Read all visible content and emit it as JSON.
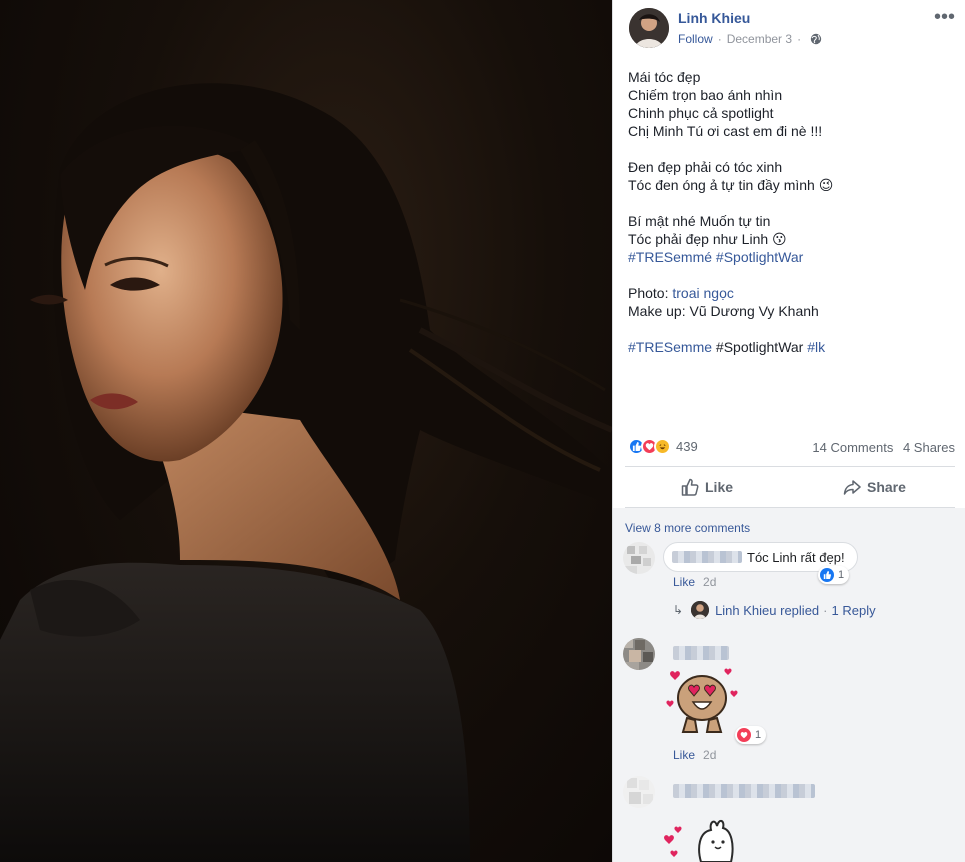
{
  "post": {
    "author": "Linh Khieu",
    "follow_label": "Follow",
    "separator": "·",
    "date": "December 3",
    "privacy_icon": "globe-icon",
    "more_label": "•••",
    "lines": [
      "Mái tóc đẹp",
      "Chiếm trọn bao ánh nhìn",
      "Chinh phục cả spotlight",
      "Chị Minh Tú ơi cast em đi nè !!!",
      "",
      "Đen đẹp phải có tóc xinh",
      "Tóc đen óng ả tự tin đầy mình 😉",
      "",
      "Bí mật nhé Muốn tự tin",
      "Tóc phải đẹp như Linh 😗"
    ],
    "hashtags_1": "#TRESemmé #SpotlightWar",
    "photo_label": "Photo: ",
    "photo_credit": "troai ngọc",
    "makeup_line": "Make up: Vũ Dương Vy Khanh",
    "hashtag_tresemme": "#TRESemme",
    "hashtag_spotlight": " #SpotlightWar ",
    "hashtag_lk": "#lk"
  },
  "engagement": {
    "reaction_count": "439",
    "comments": "14 Comments",
    "shares": "4 Shares",
    "like_button": "Like",
    "share_button": "Share"
  },
  "comments": {
    "view_more": "View 8 more comments",
    "c1_text": "Tóc Linh rất đẹp!",
    "c1_reaction_count": "1",
    "c1_like": "Like",
    "c1_time": "2d",
    "c1_reply_author": "Linh Khieu",
    "c1_reply_verb": " replied",
    "c1_reply_sep": "·",
    "c1_reply_count": "1 Reply",
    "c2_reaction_count": "1",
    "c2_like": "Like",
    "c2_time": "2d"
  },
  "colors": {
    "link": "#365899",
    "text": "#1d2129",
    "muted": "#90949c",
    "like_blue": "#1877f2",
    "love_red": "#f33e58"
  }
}
